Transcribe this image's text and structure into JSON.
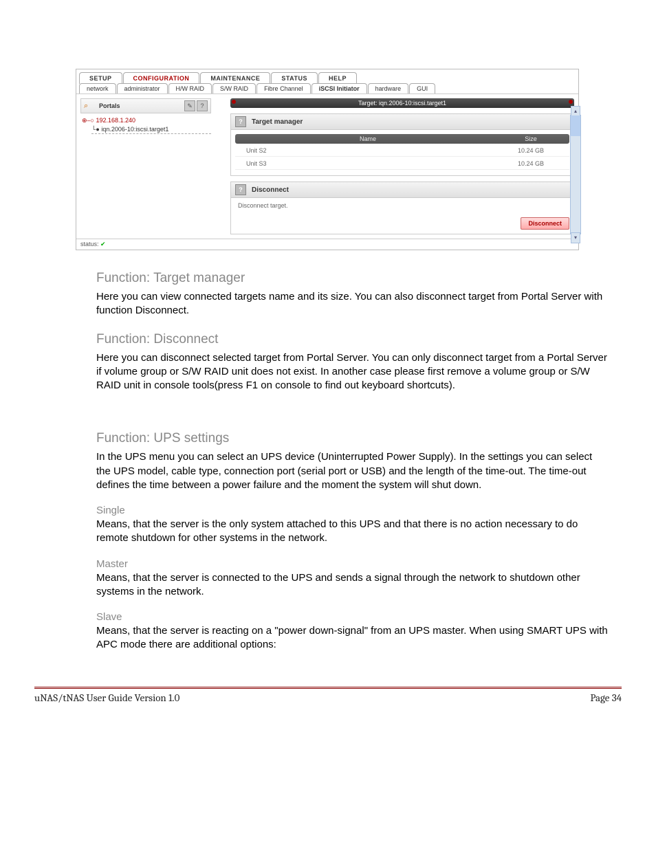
{
  "screenshot": {
    "main_tabs": [
      "SETUP",
      "CONFIGURATION",
      "MAINTENANCE",
      "STATUS",
      "HELP"
    ],
    "active_main": 1,
    "sub_tabs": [
      "network",
      "administrator",
      "H/W RAID",
      "S/W RAID",
      "Fibre Channel",
      "iSCSI Initiator",
      "hardware",
      "GUI"
    ],
    "active_sub": 5,
    "portals_label": "Portals",
    "tree_ip": "192.168.1.240",
    "tree_target": "iqn.2006-10:iscsi.target1",
    "target_header": "Target: iqn.2006-10:iscsi.target1",
    "panel1_title": "Target manager",
    "table_head_name": "Name",
    "table_head_size": "Size",
    "rows": [
      {
        "name": "Unit S2",
        "size": "10.24 GB"
      },
      {
        "name": "Unit S3",
        "size": "10.24 GB"
      }
    ],
    "panel2_title": "Disconnect",
    "panel2_text": "Disconnect target.",
    "disconnect_btn": "Disconnect",
    "status_label": "status:"
  },
  "doc": {
    "h2a": "Function: Target manager",
    "p1": "Here you can view connected targets name and its size. You can also disconnect target from Portal Server with function Disconnect.",
    "h2b": "Function: Disconnect",
    "p2": "Here you can disconnect selected target from Portal Server. You can only disconnect target from a Portal Server if volume group or S/W RAID unit does not exist. In another case please first remove a volume group or S/W RAID unit in console tools(press F1 on console to find out keyboard shortcuts).",
    "h2c": "Function: UPS settings",
    "p3": "In the UPS menu you can select an UPS device (Uninterrupted Power Supply). In the settings you can select the UPS model, cable type, connection port (serial port or USB) and the length of the time-out. The time-out defines the time between a power failure and the moment the system will shut down.",
    "h3a": "Single",
    "p4": "Means, that the server is the only system attached to this UPS and that there is no action necessary to do remote shutdown for other systems in the network.",
    "h3b": "Master",
    "p5": "Means, that the server is connected to the UPS and sends a signal through the network to shutdown other systems in the network.",
    "h3c": "Slave",
    "p6": "Means, that the server is reacting on a \"power down-signal\" from an UPS master. When using SMART UPS with APC mode there are additional options:"
  },
  "footer": {
    "left": "uNAS/tNAS User Guide Version 1.0",
    "right": "Page 34"
  }
}
